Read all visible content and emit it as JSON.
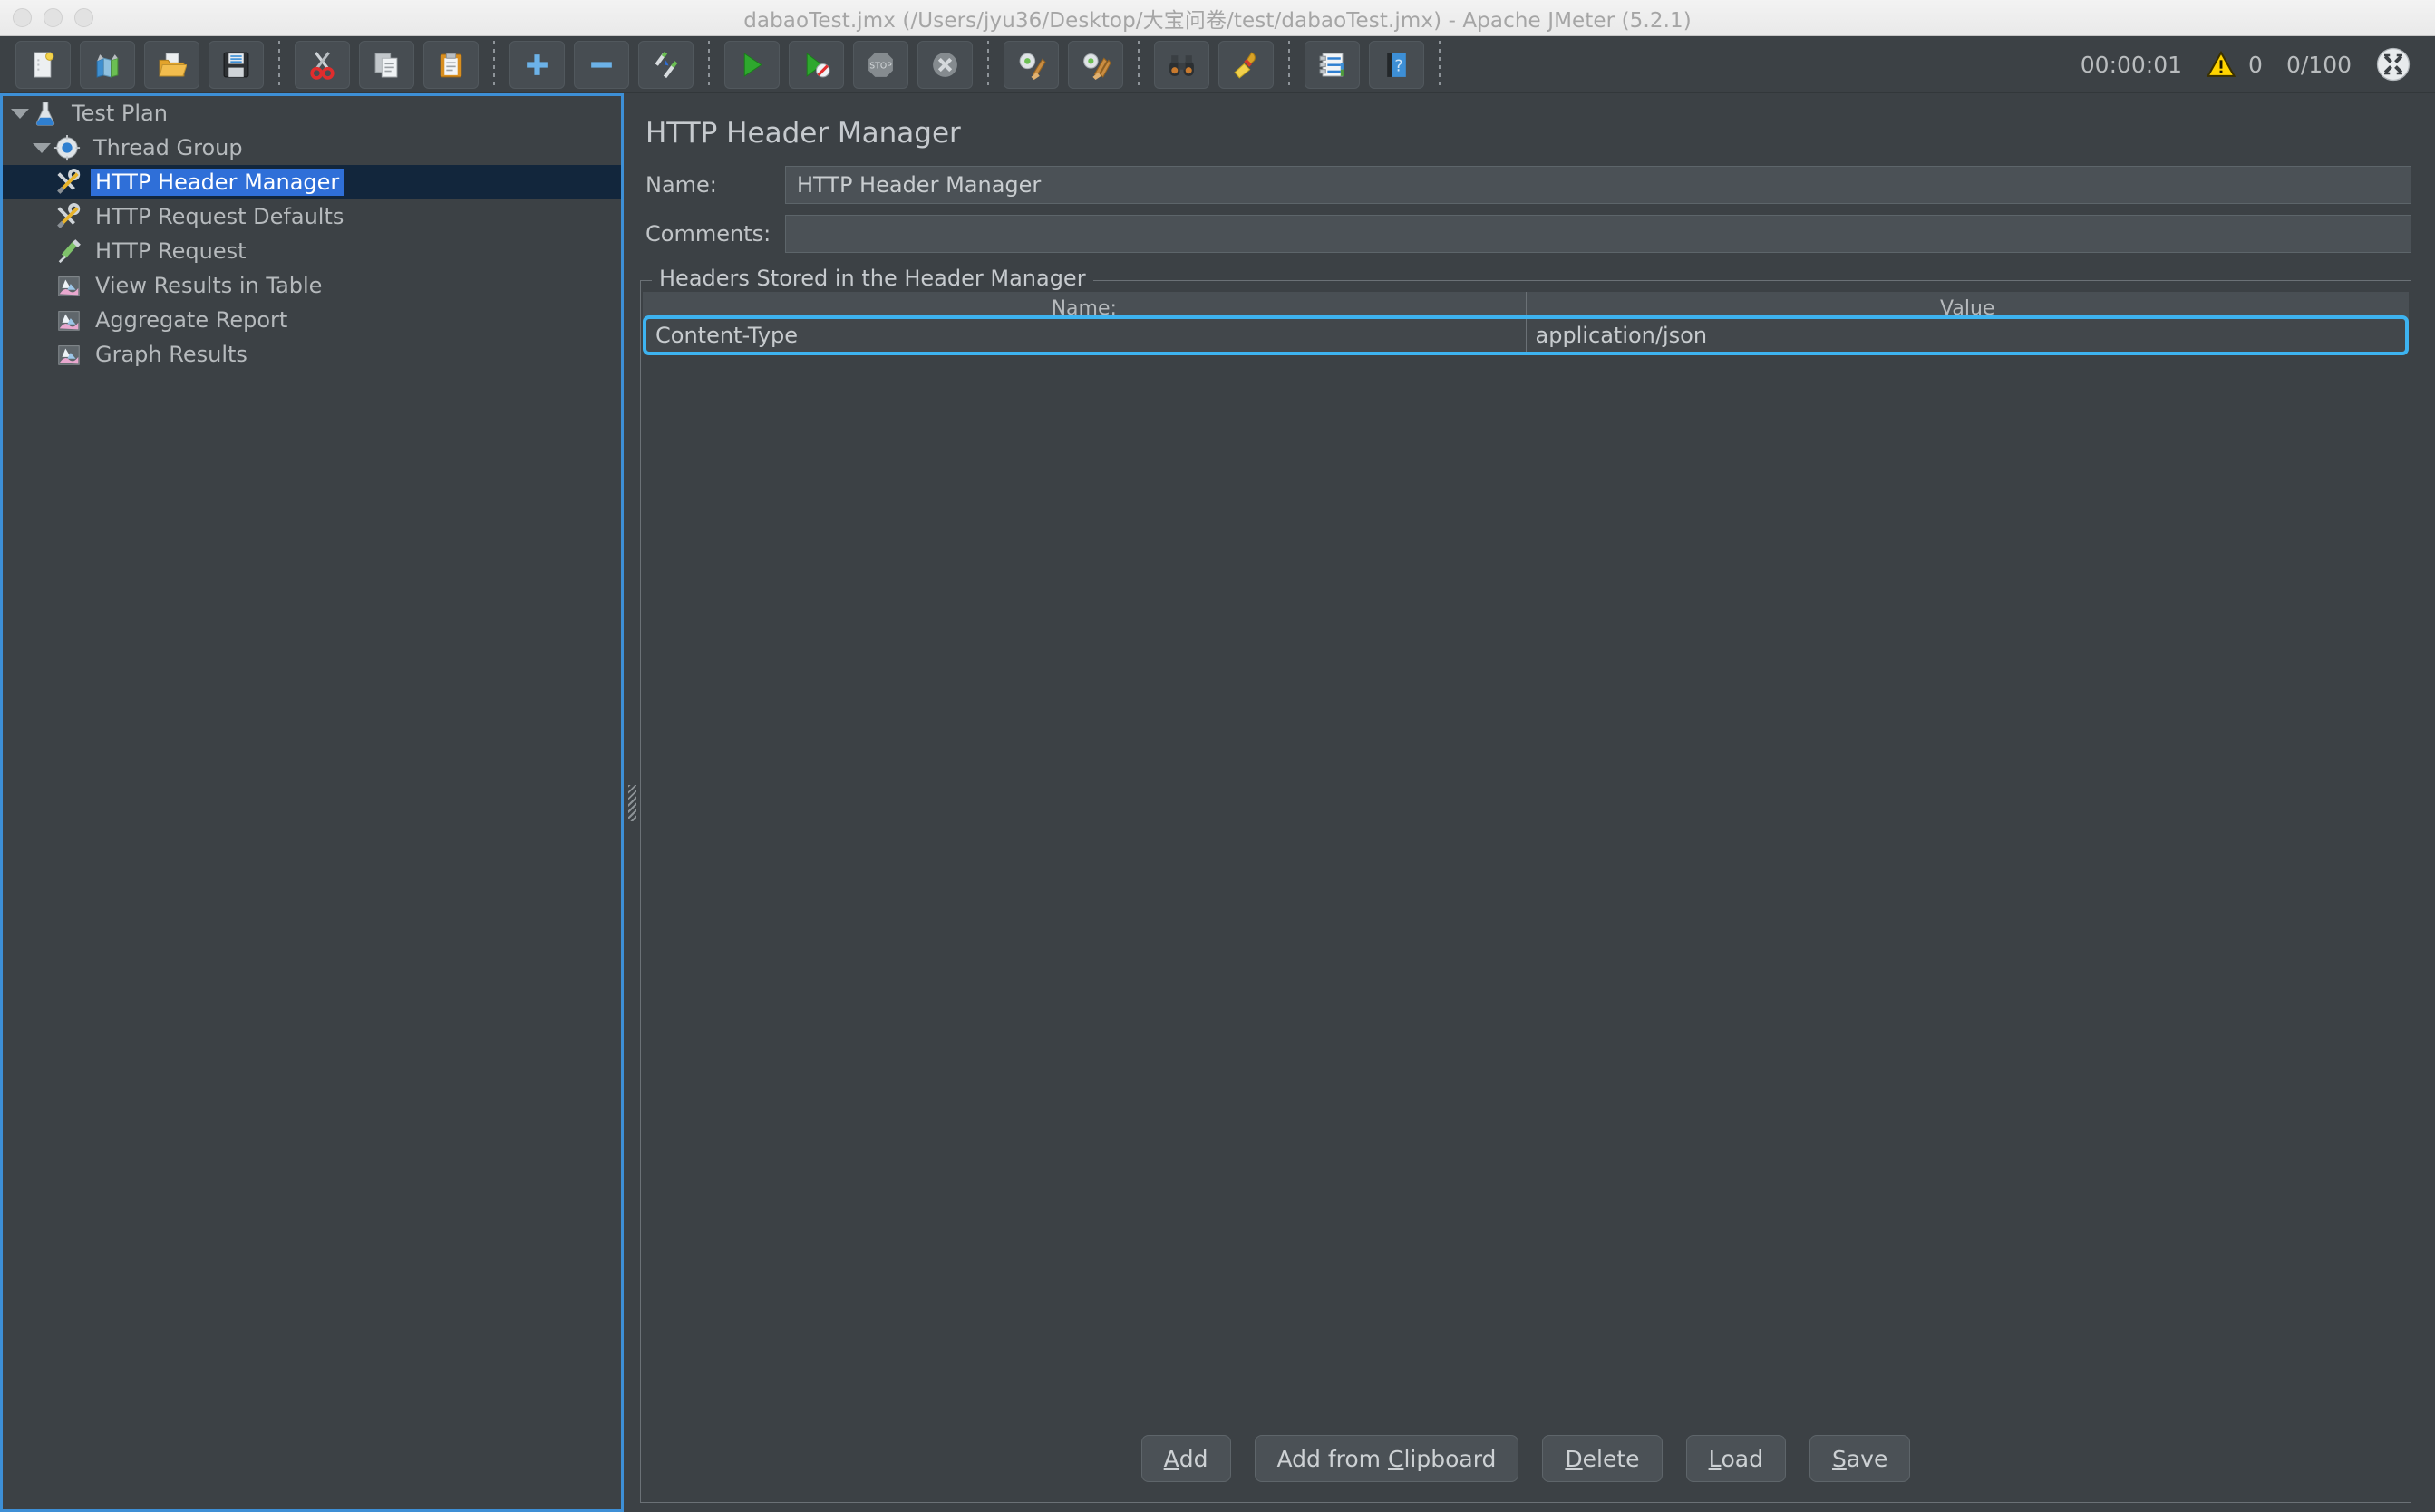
{
  "window": {
    "title": "dabaoTest.jmx (/Users/jyu36/Desktop/大宝问卷/test/dabaoTest.jmx) - Apache JMeter (5.2.1)",
    "controls": [
      "close",
      "minimize",
      "maximize"
    ]
  },
  "toolbar": {
    "buttons": [
      {
        "name": "new-button",
        "icon": "new-document-icon",
        "label": "New"
      },
      {
        "name": "templates-button",
        "icon": "templates-icon",
        "label": "Templates"
      },
      {
        "name": "open-button",
        "icon": "open-folder-icon",
        "label": "Open"
      },
      {
        "name": "save-button",
        "icon": "floppy-save-icon",
        "label": "Save"
      },
      {
        "name": "cut-button",
        "icon": "scissors-icon",
        "label": "Cut"
      },
      {
        "name": "copy-button",
        "icon": "copy-pages-icon",
        "label": "Copy"
      },
      {
        "name": "paste-button",
        "icon": "clipboard-paste-icon",
        "label": "Paste"
      },
      {
        "name": "expand-all-button",
        "icon": "plus-icon",
        "label": "Expand All"
      },
      {
        "name": "collapse-all-button",
        "icon": "minus-icon",
        "label": "Collapse All"
      },
      {
        "name": "toggle-button",
        "icon": "toggle-pencils-icon",
        "label": "Toggle"
      },
      {
        "name": "start-button",
        "icon": "green-play-icon",
        "label": "Start"
      },
      {
        "name": "start-no-pauses-button",
        "icon": "green-play-no-pause-icon",
        "label": "Start no pauses"
      },
      {
        "name": "stop-button",
        "icon": "stop-sign-icon",
        "label": "Stop"
      },
      {
        "name": "shutdown-button",
        "icon": "shutdown-x-icon",
        "label": "Shutdown"
      },
      {
        "name": "clear-button",
        "icon": "gear-broom-icon",
        "label": "Clear"
      },
      {
        "name": "clear-all-button",
        "icon": "gear-broom-all-icon",
        "label": "Clear All"
      },
      {
        "name": "search-button",
        "icon": "binoculars-icon",
        "label": "Search"
      },
      {
        "name": "reset-search-button",
        "icon": "yellow-broom-icon",
        "label": "Reset Search"
      },
      {
        "name": "log-viewer-button",
        "icon": "log-list-icon",
        "label": "Toggle Log Viewer"
      },
      {
        "name": "help-button",
        "icon": "blue-help-book-icon",
        "label": "Help"
      }
    ],
    "separators_after": [
      3,
      6,
      9,
      13,
      15,
      17,
      19
    ],
    "status": {
      "elapsed_time": "00:00:01",
      "warning_icon": "warning-triangle-icon",
      "warning_count": "0",
      "threads": "0/100",
      "remote_icon": "remote-engines-icon"
    }
  },
  "tree": {
    "nodes": [
      {
        "label": "Test Plan",
        "icon": "test-plan-flask-icon",
        "level": 1,
        "expanded": true,
        "selected": false
      },
      {
        "label": "Thread Group",
        "icon": "thread-group-gear-icon",
        "level": 2,
        "expanded": true,
        "selected": false
      },
      {
        "label": "HTTP Header Manager",
        "icon": "config-tools-icon",
        "level": 3,
        "expanded": null,
        "selected": true
      },
      {
        "label": "HTTP Request Defaults",
        "icon": "config-tools-icon",
        "level": 3,
        "expanded": null,
        "selected": false
      },
      {
        "label": "HTTP Request",
        "icon": "sampler-pen-icon",
        "level": 3,
        "expanded": null,
        "selected": false
      },
      {
        "label": "View Results in Table",
        "icon": "listener-chart-icon",
        "level": 3,
        "expanded": null,
        "selected": false
      },
      {
        "label": "Aggregate Report",
        "icon": "listener-chart-icon",
        "level": 3,
        "expanded": null,
        "selected": false
      },
      {
        "label": "Graph Results",
        "icon": "listener-chart-icon",
        "level": 3,
        "expanded": null,
        "selected": false
      }
    ]
  },
  "editor": {
    "title": "HTTP Header Manager",
    "name_label": "Name:",
    "name_value": "HTTP Header Manager",
    "comments_label": "Comments:",
    "comments_value": "",
    "comments_placeholder": "",
    "group_legend": "Headers Stored in the Header Manager",
    "table": {
      "columns": [
        "Name:",
        "Value"
      ],
      "rows": [
        {
          "name": "Content-Type",
          "value": "application/json",
          "selected": true
        }
      ]
    },
    "buttons": [
      {
        "name": "add-button",
        "label": "Add",
        "mnemonic": "A"
      },
      {
        "name": "add-from-clipboard-button",
        "label": "Add from Clipboard",
        "mnemonic": "C"
      },
      {
        "name": "delete-button",
        "label": "Delete",
        "mnemonic": "D"
      },
      {
        "name": "load-button",
        "label": "Load",
        "mnemonic": "L"
      },
      {
        "name": "save-headers-button",
        "label": "Save",
        "mnemonic": "S"
      }
    ]
  },
  "colors": {
    "background": "#3c4145",
    "selection_blue": "#2f6fd8",
    "focus_border": "#3d8fd6",
    "row_focus": "#3db3f0",
    "text": "#c0c4c7",
    "warning_yellow": "#ffd400"
  }
}
